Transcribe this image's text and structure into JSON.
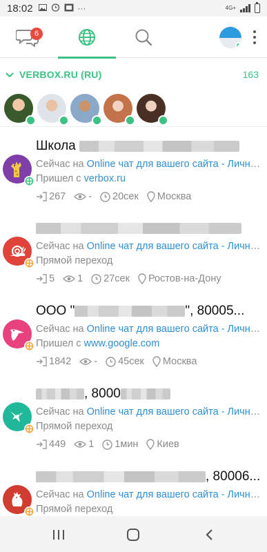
{
  "status_bar": {
    "time": "18:02",
    "network": "4G+",
    "icons": [
      "image-icon",
      "alarm-icon",
      "cast-icon",
      "more-icon",
      "signal-icon",
      "battery-icon"
    ]
  },
  "tabs": [
    {
      "name": "chats",
      "icon": "chat-bubbles-icon",
      "badge": "6"
    },
    {
      "name": "visitors",
      "icon": "globe-icon",
      "active": true
    },
    {
      "name": "search",
      "icon": "search-icon"
    }
  ],
  "site": {
    "name": "VERBOX.RU (RU)",
    "count": "163"
  },
  "colors": {
    "accent": "#3cc283",
    "link": "#2f8fd3",
    "badge": "#e84a3c",
    "meta": "#8a8a8a"
  },
  "operators_count": 5,
  "visitors": [
    {
      "name": "Школа",
      "name_tail": "",
      "now_prefix": "Сейчас на",
      "page": "Online чат для вашего сайта - Личный кабинет",
      "source_prefix": "Пришел с",
      "source_link": "verbox.ru",
      "source_plain": "",
      "visits": "267",
      "views": "-",
      "time": "20сек",
      "city": "Москва",
      "avatar_color": "#7f3fa8",
      "avatar_icon": "giraffe-icon"
    },
    {
      "name": "",
      "name_tail": "",
      "now_prefix": "Сейчас на",
      "page": "Online чат для вашего сайта - Личный кабинет",
      "source_prefix": "",
      "source_link": "",
      "source_plain": "Прямой переход",
      "visits": "5",
      "views": "1",
      "time": "27сек",
      "city": "Ростов-на-Дону",
      "avatar_color": "#e0433a",
      "avatar_icon": "snail-icon"
    },
    {
      "name": "ООО \"",
      "name_tail": "\", 80005...",
      "now_prefix": "Сейчас на",
      "page": "Online чат для вашего сайта - Личный кабинет",
      "source_prefix": "Пришел с",
      "source_link": "www.google.com",
      "source_plain": "",
      "visits": "1842",
      "views": "-",
      "time": "45сек",
      "city": "Москва",
      "avatar_color": "#e8427e",
      "avatar_icon": "pelican-icon"
    },
    {
      "name": "",
      "name_tail": ", 8000",
      "now_prefix": "Сейчас на",
      "page": "Online чат для вашего сайта - Личный кабинет",
      "source_prefix": "",
      "source_link": "",
      "source_plain": "Прямой переход",
      "visits": "449",
      "views": "1",
      "time": "1мин",
      "city": "Киев",
      "avatar_color": "#1fb99a",
      "avatar_icon": "hummingbird-icon"
    },
    {
      "name": "",
      "name_tail": ", 80006...",
      "now_prefix": "Сейчас на",
      "page": "Online чат для вашего сайта - Личный кабинет",
      "source_prefix": "",
      "source_link": "",
      "source_plain": "Прямой переход",
      "visits": "",
      "views": "",
      "time": "",
      "city": "",
      "avatar_color": "#d23b2f",
      "avatar_icon": "rooster-icon"
    }
  ]
}
